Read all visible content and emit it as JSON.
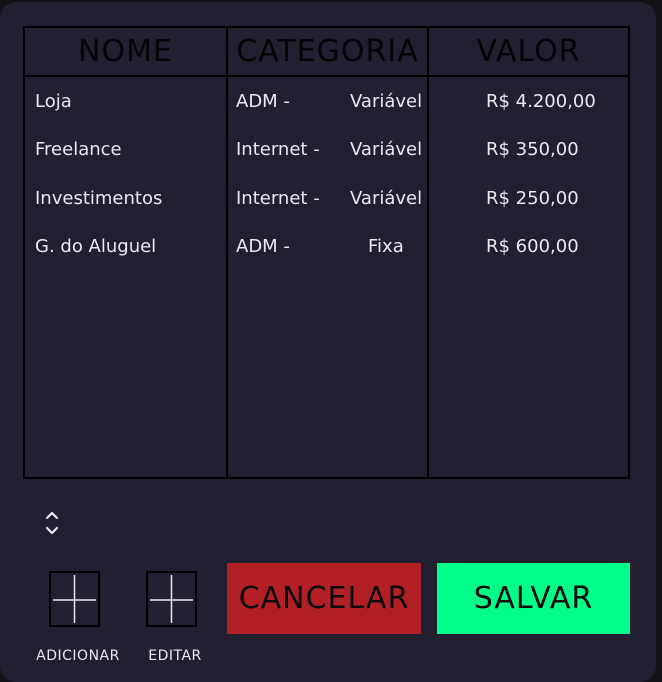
{
  "table": {
    "headers": [
      "NOME",
      "CATEGORIA",
      "VALOR"
    ],
    "rows": [
      {
        "nome": "Loja",
        "categoria_a": "ADM -",
        "categoria_b": "Variável",
        "valor": "R$ 4.200,00"
      },
      {
        "nome": "Freelance",
        "categoria_a": "Internet -",
        "categoria_b": "Variável",
        "valor": "R$ 350,00"
      },
      {
        "nome": "Investimentos",
        "categoria_a": "Internet -",
        "categoria_b": "Variável",
        "valor": "R$ 250,00"
      },
      {
        "nome": "G. do Aluguel",
        "categoria_a": "ADM -",
        "categoria_b": "Fixa",
        "valor": "R$ 600,00"
      }
    ]
  },
  "actions": {
    "add_label": "ADICIONAR",
    "edit_label": "EDITAR",
    "cancel_label": "CANCELAR",
    "save_label": "SALVAR"
  },
  "colors": {
    "panel_bg": "#221f31",
    "cancel_bg": "#b21f24",
    "save_bg": "#00ff88"
  },
  "icons": {
    "sort": "sort-updown-icon",
    "add": "plus-icon",
    "edit": "plus-icon"
  }
}
